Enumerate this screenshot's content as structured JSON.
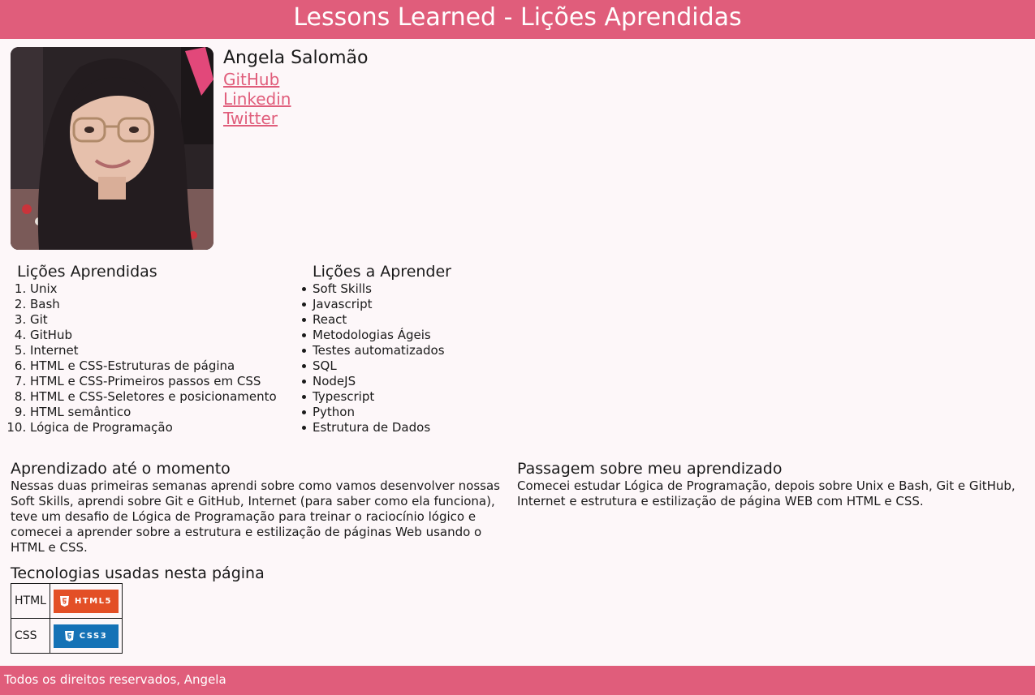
{
  "header": {
    "title": "Lessons Learned - Lições Aprendidas"
  },
  "profile": {
    "name": "Angela Salomão",
    "links": [
      "GitHub",
      "Linkedin",
      "Twitter"
    ]
  },
  "learned": {
    "title": "Lições Aprendidas",
    "items": [
      "Unix",
      "Bash",
      "Git",
      "GitHub",
      "Internet",
      "HTML e CSS-Estruturas de página",
      "HTML e CSS-Primeiros passos em CSS",
      "HTML e CSS-Seletores e posicionamento",
      "HTML semântico",
      "Lógica de Programação"
    ]
  },
  "to_learn": {
    "title": "Lições a Aprender",
    "items": [
      "Soft Skills",
      "Javascript",
      "React",
      "Metodologias Ágeis",
      "Testes automatizados",
      "SQL",
      "NodeJS",
      "Typescript",
      "Python",
      "Estrutura de Dados"
    ]
  },
  "learning_so_far": {
    "title": "Aprendizado até o momento",
    "text": "Nessas duas primeiras semanas aprendi sobre como vamos desenvolver nossas Soft Skills, aprendi sobre Git e GitHub, Internet (para saber como ela funciona), teve um desafio de Lógica de Programação para treinar o raciocínio lógico e comecei a aprender sobre a estrutura e estilização de páginas Web usando o HTML e CSS."
  },
  "passage": {
    "title": "Passagem sobre meu aprendizado",
    "text": "Comecei estudar Lógica de Programação, depois sobre Unix e Bash, Git e GitHub, Internet e estrutura e estilização de página WEB com HTML e CSS."
  },
  "technologies": {
    "title": "Tecnologias usadas nesta página",
    "rows": [
      {
        "label": "HTML",
        "badge": "HTML5",
        "color": "#e34f26",
        "icon": "html5-shield-icon"
      },
      {
        "label": "CSS",
        "badge": "CSS3",
        "color": "#1572b6",
        "icon": "css3-shield-icon"
      }
    ]
  },
  "footer": {
    "text": "Todos os direitos reservados, Angela"
  },
  "colors": {
    "accent": "#e05d7b",
    "background": "#fdf7f9"
  }
}
